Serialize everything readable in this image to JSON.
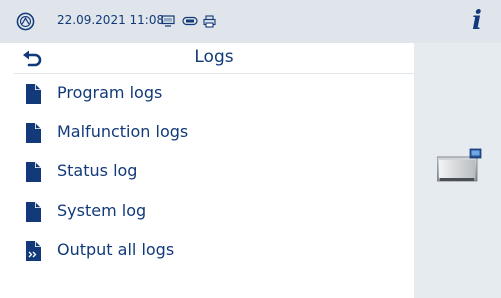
{
  "status": {
    "datetime": "22.09.2021 11:08",
    "icons": [
      "brand-logo-icon",
      "monitor-icon",
      "usb-icon",
      "printer-icon"
    ],
    "info_label": "i"
  },
  "header": {
    "title": "Logs",
    "back_icon": "back-arrow-icon"
  },
  "items": [
    {
      "label": "Program logs",
      "icon": "document-icon"
    },
    {
      "label": "Malfunction logs",
      "icon": "document-icon"
    },
    {
      "label": "Status log",
      "icon": "document-icon"
    },
    {
      "label": "System log",
      "icon": "document-icon"
    },
    {
      "label": "Output all logs",
      "icon": "document-output-icon"
    }
  ],
  "device_icon": "sterilizer-device-icon",
  "colors": {
    "brand": "#123a7a",
    "status_bar": "#dfe5ea",
    "side_pane": "#e6ebef"
  }
}
